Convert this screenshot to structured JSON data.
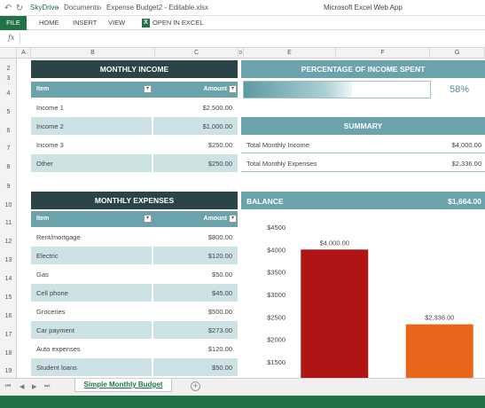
{
  "titlebar": {
    "crumbs": [
      "SkyDrive",
      "Documents",
      "Expense Budget2 - Editable.xlsx"
    ],
    "separator": "›",
    "app_title": "Microsoft Excel Web App"
  },
  "ribbon": {
    "tabs": [
      "FILE",
      "HOME",
      "INSERT",
      "VIEW"
    ],
    "open_in_excel": "OPEN IN EXCEL"
  },
  "formula_bar": {
    "fx": "fx",
    "value": ""
  },
  "columns": [
    "A",
    "B",
    "C",
    "D",
    "E",
    "F",
    "G"
  ],
  "rows": [
    "2",
    "3",
    "4",
    "5",
    "6",
    "7",
    "8",
    "9",
    "10",
    "11",
    "12",
    "13",
    "14",
    "15",
    "16",
    "17",
    "18",
    "19"
  ],
  "income": {
    "title": "MONTHLY INCOME",
    "col_item": "Item",
    "col_amount": "Amount",
    "items": [
      {
        "label": "Income 1",
        "amount": "$2,500.00"
      },
      {
        "label": "Income 2",
        "amount": "$1,000.00"
      },
      {
        "label": "Income 3",
        "amount": "$250.00"
      },
      {
        "label": "Other",
        "amount": "$250.00"
      }
    ]
  },
  "percentage": {
    "title": "PERCENTAGE OF INCOME SPENT",
    "value_text": "58%",
    "value": 0.58
  },
  "summary": {
    "title": "SUMMARY",
    "rows": [
      {
        "label": "Total Monthly Income",
        "amount": "$4,000.00"
      },
      {
        "label": "Total Monthly Expenses",
        "amount": "$2,336.00"
      }
    ]
  },
  "expenses": {
    "title": "MONTHLY EXPENSES",
    "col_item": "Item",
    "col_amount": "Amount",
    "items": [
      {
        "label": "Rent/mortgage",
        "amount": "$800.00"
      },
      {
        "label": "Electric",
        "amount": "$120.00"
      },
      {
        "label": "Gas",
        "amount": "$50.00"
      },
      {
        "label": "Cell phone",
        "amount": "$45.00"
      },
      {
        "label": "Groceries",
        "amount": "$500.00"
      },
      {
        "label": "Car payment",
        "amount": "$273.00"
      },
      {
        "label": "Auto expenses",
        "amount": "$120.00"
      },
      {
        "label": "Student loans",
        "amount": "$50.00"
      }
    ]
  },
  "balance": {
    "label": "BALANCE",
    "value": "$1,664.00"
  },
  "chart_data": {
    "type": "bar",
    "categories": [
      "",
      ""
    ],
    "values": [
      4000,
      2336
    ],
    "data_labels": [
      "$4,000.00",
      "$2,336.00"
    ],
    "colors": [
      "#b01515",
      "#e8651a"
    ],
    "y_ticks": [
      "$4500",
      "$4000",
      "$3500",
      "$3000",
      "$2500",
      "$2000",
      "$1500"
    ],
    "ylim": [
      1500,
      4500
    ],
    "title": "",
    "xlabel": "",
    "ylabel": ""
  },
  "sheet_tabs": {
    "active": "Simple Monthly Budget",
    "add": "+"
  },
  "nav_arrows": [
    "⏮",
    "◀",
    "▶",
    "⏭"
  ],
  "colors": {
    "accent": "#217346",
    "dark_teal": "#2b4447",
    "teal": "#6aa3ab",
    "light_teal": "#cde2e5"
  }
}
